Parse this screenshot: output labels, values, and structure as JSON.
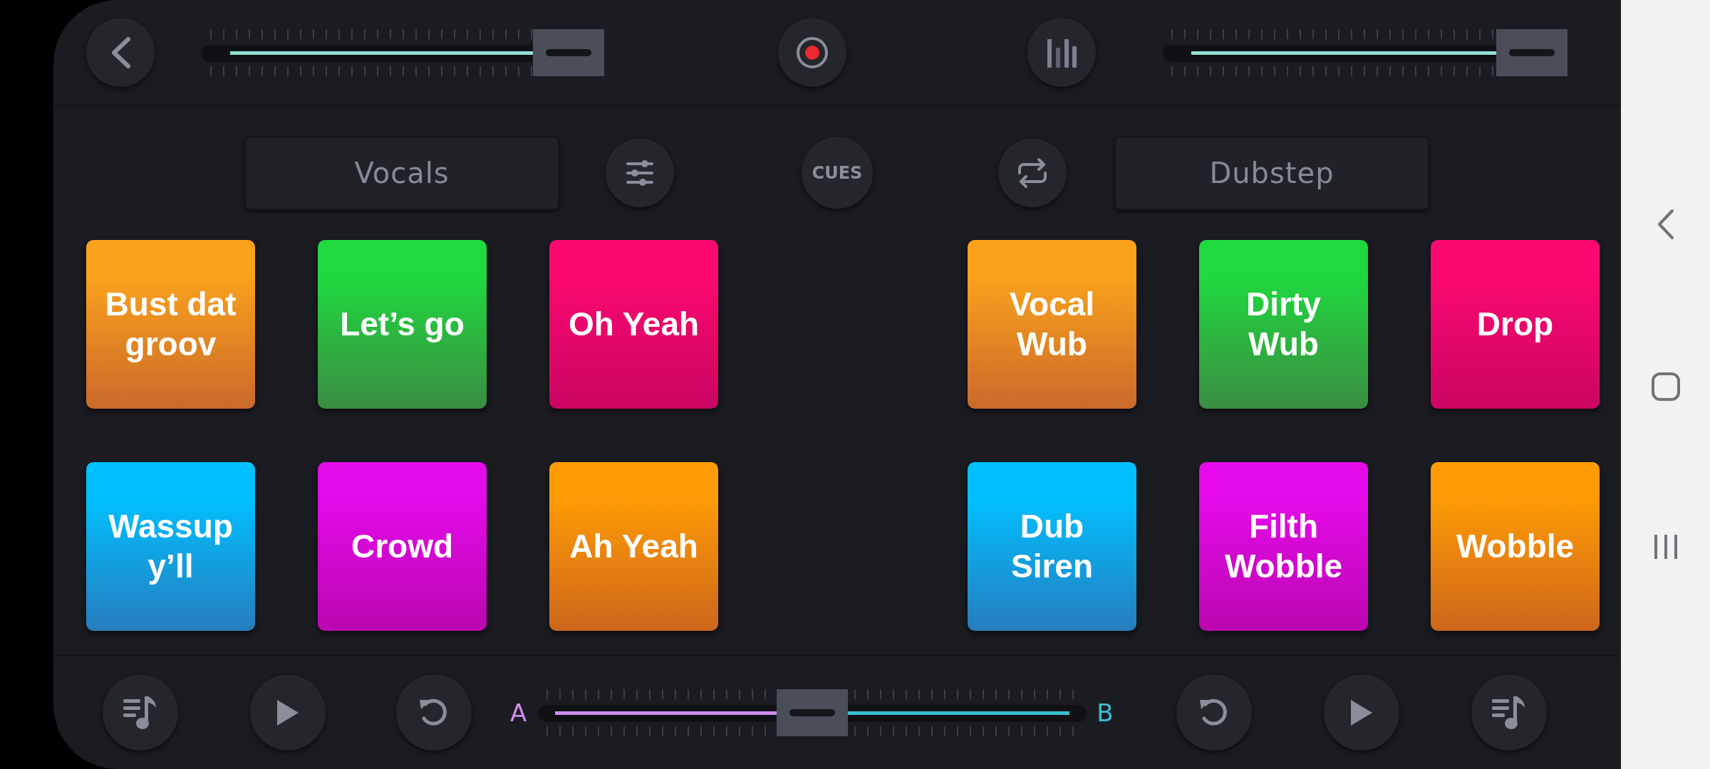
{
  "top_bar": {
    "left_slider": {
      "level": 1
    },
    "right_slider": {
      "level": 1
    }
  },
  "left_deck": {
    "category": "Vocals",
    "pads": [
      {
        "label": "Bust dat\ngroov",
        "color": "#fba21c"
      },
      {
        "label": "Let’s go",
        "color": "#1fd93f"
      },
      {
        "label": "Oh Yeah",
        "color": "#fb0870"
      },
      {
        "label": "Wassup\ny’ll",
        "color": "#00c0ff"
      },
      {
        "label": "Crowd",
        "color": "#e40ae9"
      },
      {
        "label": "Ah Yeah",
        "color": "#ff9c05"
      }
    ]
  },
  "cues_button": "CUES",
  "right_deck": {
    "category": "Dubstep",
    "pads": [
      {
        "label": "Vocal\nWub",
        "color": "#fba21c"
      },
      {
        "label": "Dirty\nWub",
        "color": "#1fd93f"
      },
      {
        "label": "Drop",
        "color": "#fb0870"
      },
      {
        "label": "Dub\nSiren",
        "color": "#00c0ff"
      },
      {
        "label": "Filth\nWobble",
        "color": "#e40ae9"
      },
      {
        "label": "Wobble",
        "color": "#ff9c05"
      }
    ]
  },
  "crossfader": {
    "label_a": "A",
    "label_b": "B",
    "level": 0.5
  }
}
